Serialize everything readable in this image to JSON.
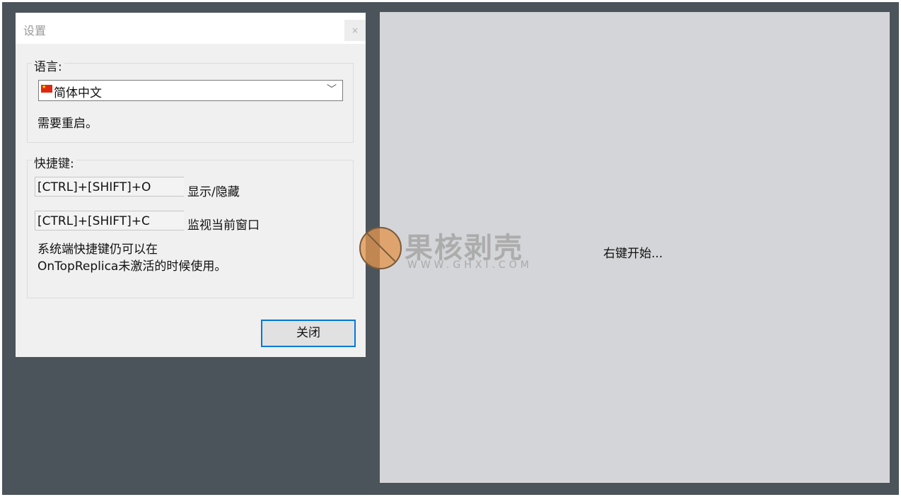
{
  "dialog": {
    "title": "设置",
    "close_glyph": "×",
    "language": {
      "group_label": "语言:",
      "selected": "简体中文",
      "flag_icon": "china-flag",
      "note": "需要重启。"
    },
    "hotkeys": {
      "group_label": "快捷键:",
      "items": [
        {
          "keys": "[CTRL]+[SHIFT]+O",
          "label": "显示/隐藏"
        },
        {
          "keys": "[CTRL]+[SHIFT]+C",
          "label": "监视当前窗口"
        }
      ],
      "note": "系统端快捷键仍可以在OnTopReplica未激活的时候使用。"
    },
    "close_button": "关闭"
  },
  "preview": {
    "hint": "右键开始..."
  },
  "watermark": {
    "brand": "果核剥壳",
    "url": "WWW.GHXI.COM"
  },
  "colors": {
    "desktop": "#4b545b",
    "dialog_bg": "#f0f0f0",
    "preview_bg": "#d4d5d8",
    "accent": "#0078d7"
  }
}
